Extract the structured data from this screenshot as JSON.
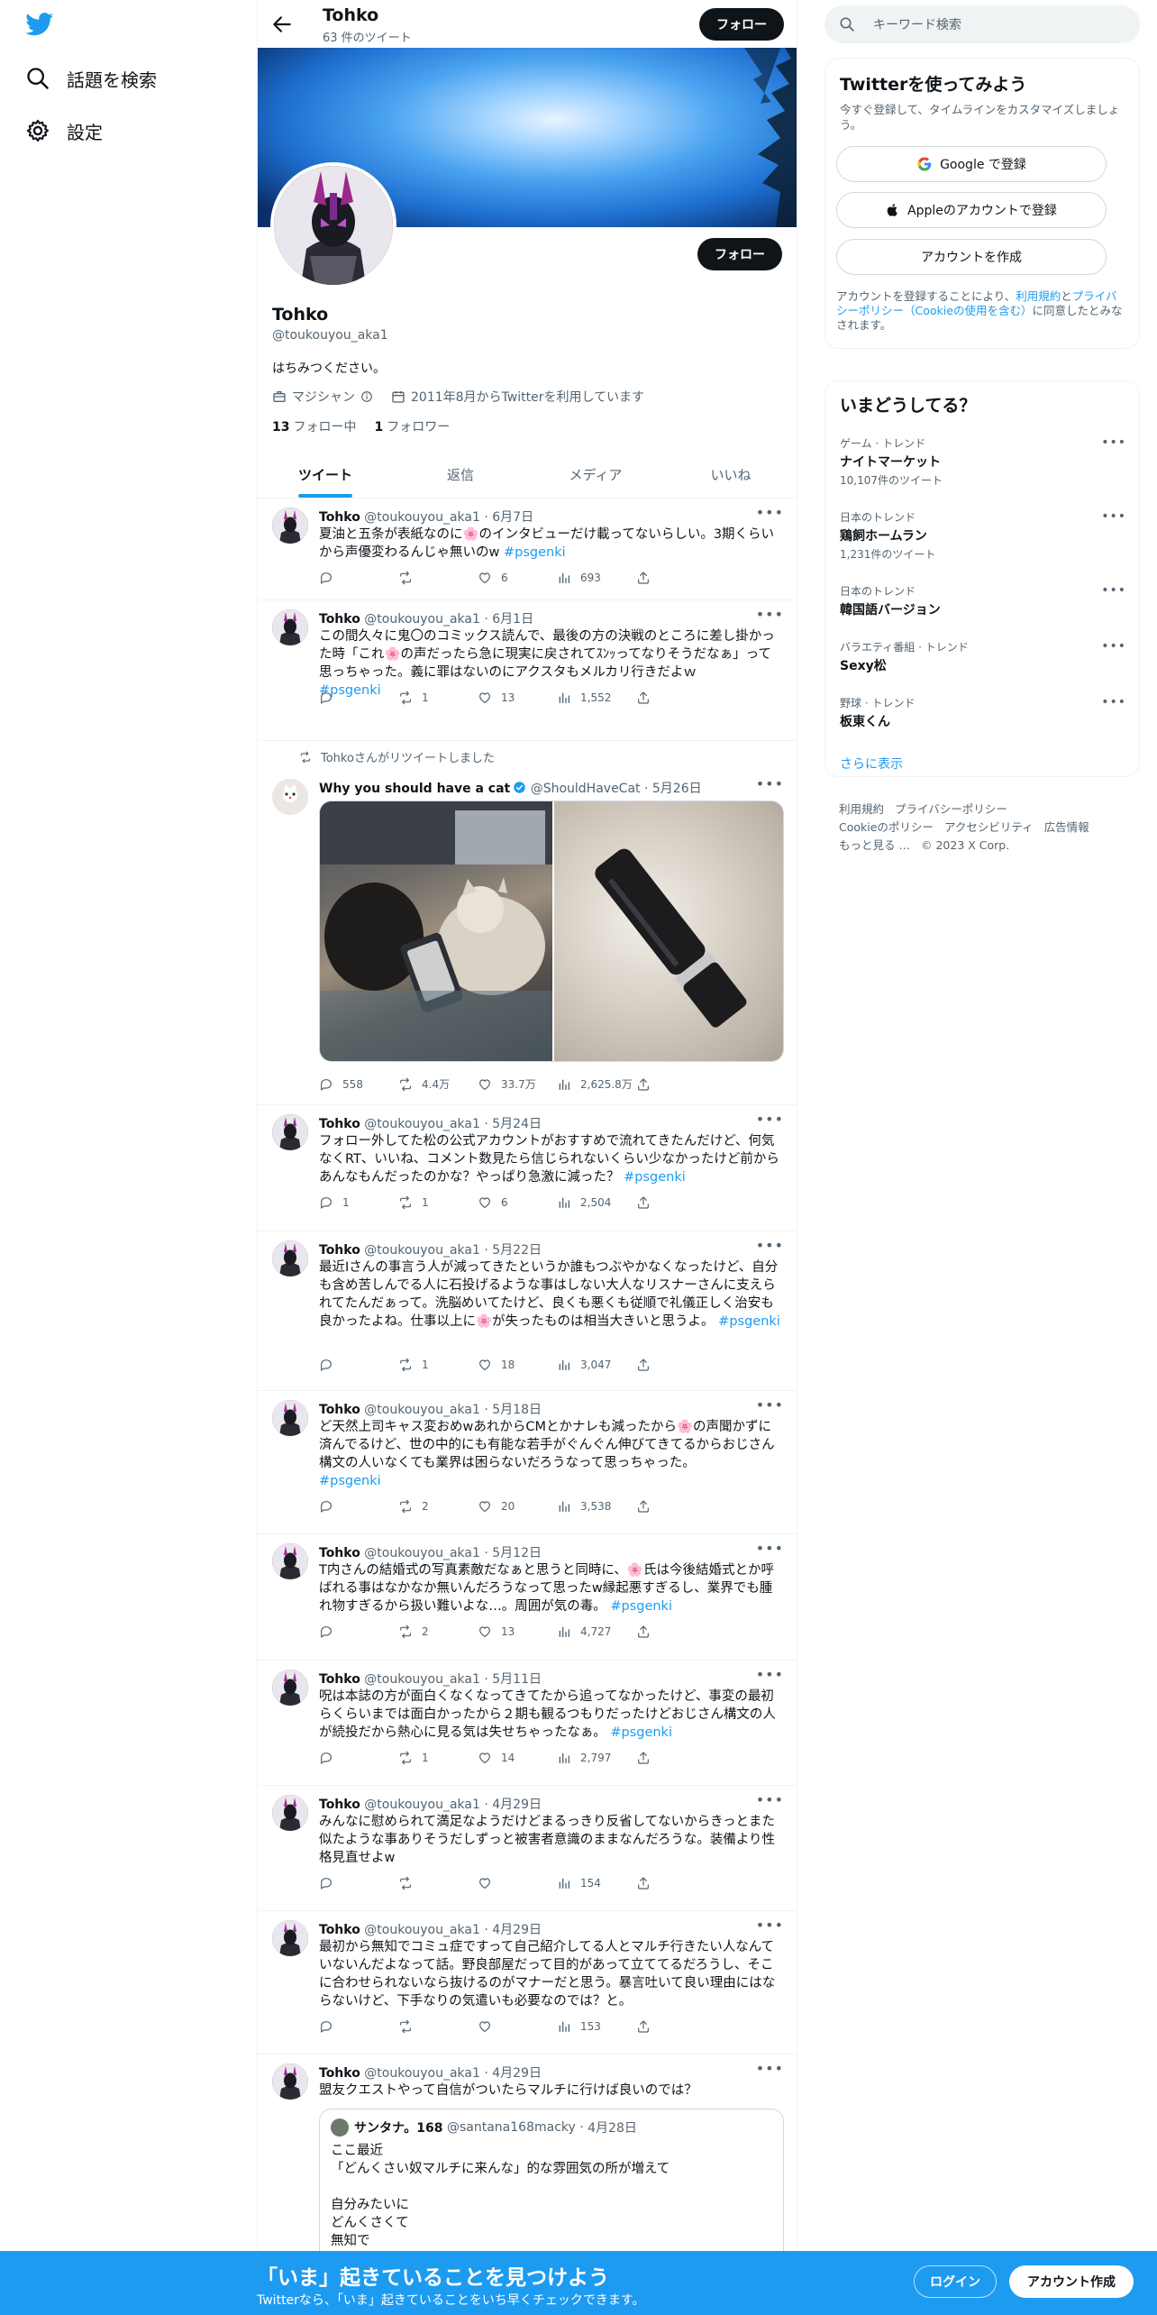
{
  "nav": {
    "explore_label": "話題を検索",
    "settings_label": "設定"
  },
  "header": {
    "name": "Tohko",
    "tweet_count": "63 件のツイート",
    "follow_label": "フォロー"
  },
  "profile": {
    "follow_label": "フォロー",
    "name": "Tohko",
    "handle": "@toukouyou_aka1",
    "bio": "はちみつください。",
    "job": "マジシャン",
    "joined": "2011年8月からTwitterを利用しています",
    "following_count": "13",
    "following_label": "フォロー中",
    "followers_count": "1",
    "followers_label": "フォロワー"
  },
  "tabs": [
    "ツイート",
    "返信",
    "メディア",
    "いいね"
  ],
  "tweets": [
    {
      "name": "Tohko",
      "handle": "@toukouyou_aka1",
      "date": "6月7日",
      "text": "夏油と五条が表紙なのに🌸のインタビューだけ載ってないらしい。3期くらいから声優変わるんじゃ無いのw ",
      "tag": "#psgenki",
      "reply": "",
      "retweet": "",
      "like": "6",
      "views": "693"
    },
    {
      "name": "Tohko",
      "handle": "@toukouyou_aka1",
      "date": "6月1日",
      "text": "この間久々に鬼〇のコミックス読んで、最後の方の決戦のところに差し掛かった時「これ🌸の声だったら急に現実に戻されてｽﾝｯってなりそうだなぁ」って思っちゃった。義に罪はないのにアクスタもメルカリ行きだよｗ\n",
      "tag": "#psgenki",
      "reply": "",
      "retweet": "1",
      "like": "13",
      "views": "1,552"
    },
    {
      "retweeted_by": "Tohkoさんがリツイートしました",
      "name": "Why you should have a cat",
      "handle": "@ShouldHaveCat",
      "date": "5月26日",
      "text": "",
      "tag": "",
      "reply": "558",
      "retweet": "4.4万",
      "like": "33.7万",
      "views": "2,625.8万"
    },
    {
      "name": "Tohko",
      "handle": "@toukouyou_aka1",
      "date": "5月24日",
      "text": "フォロー外してた松の公式アカウントがおすすめで流れてきたんだけど、何気なくRT、いいね、コメント数見たら信じられないくらい少なかったけど前からあんなもんだったのかな？やっぱり急激に減った？ ",
      "tag": "#psgenki",
      "reply": "1",
      "retweet": "1",
      "like": "6",
      "views": "2,504"
    },
    {
      "name": "Tohko",
      "handle": "@toukouyou_aka1",
      "date": "5月22日",
      "text": "最近Iさんの事言う人が減ってきたというか誰もつぶやかなくなったけど、自分も含め苦しんでる人に石投げるような事はしない大人なリスナーさんに支えられてたんだぁって。洗脳めいてたけど、良くも悪くも従順で礼儀正しく治安も良かったよね。仕事以上に🌸が失ったものは相当大きいと思うよ。 ",
      "tag": "#psgenki",
      "reply": "",
      "retweet": "1",
      "like": "18",
      "views": "3,047"
    },
    {
      "name": "Tohko",
      "handle": "@toukouyou_aka1",
      "date": "5月18日",
      "text": "ど天然上司キャス変おめwあれからCMとかナレも減ったから🌸の声聞かずに済んでるけど、世の中的にも有能な若手がぐんぐん伸びてきてるからおじさん構文の人いなくても業界は困らないだろうなって思っちゃった。\n",
      "tag": "#psgenki",
      "reply": "",
      "retweet": "2",
      "like": "20",
      "views": "3,538"
    },
    {
      "name": "Tohko",
      "handle": "@toukouyou_aka1",
      "date": "5月12日",
      "text": "T内さんの結婚式の写真素敵だなぁと思うと同時に、🌸氏は今後結婚式とか呼ばれる事はなかなか無いんだろうなって思ったw縁起悪すぎるし、業界でも腫れ物すぎるから扱い難いよな…。周囲が気の毒。 ",
      "tag": "#psgenki",
      "reply": "",
      "retweet": "2",
      "like": "13",
      "views": "4,727"
    },
    {
      "name": "Tohko",
      "handle": "@toukouyou_aka1",
      "date": "5月11日",
      "text": "呪は本誌の方が面白くなくなってきてたから追ってなかったけど、事変の最初らくらいまでは面白かったから２期も観るつもりだったけどおじさん構文の人が続投だから熱心に見る気は失せちゃったなぁ。 ",
      "tag": "#psgenki",
      "reply": "",
      "retweet": "1",
      "like": "14",
      "views": "2,797"
    },
    {
      "name": "Tohko",
      "handle": "@toukouyou_aka1",
      "date": "4月29日",
      "text": "みんなに慰められて満足なようだけどまるっきり反省してないからきっとまた似たような事ありそうだしずっと被害者意識のままなんだろうな。装備より性格見直せよw",
      "tag": "",
      "reply": "",
      "retweet": "",
      "like": "",
      "views": "154"
    },
    {
      "name": "Tohko",
      "handle": "@toukouyou_aka1",
      "date": "4月29日",
      "text": "最初から無知でコミュ症ですって自己紹介してる人とマルチ行きたい人なんていないんだよなって話。野良部屋だって目的があって立ててるだろうし、そこに合わせられないなら抜けるのがマナーだと思う。暴言吐いて良い理由にはならないけど、下手なりの気遣いも必要なのでは？と。",
      "tag": "",
      "reply": "",
      "retweet": "",
      "like": "",
      "views": "153"
    },
    {
      "name": "Tohko",
      "handle": "@toukouyou_aka1",
      "date": "4月29日",
      "text": "盟友クエストやって自信がついたらマルチに行けば良いのでは？",
      "tag": "",
      "reply": "",
      "retweet": "",
      "like": "",
      "views": ""
    }
  ],
  "quote": {
    "name": "サンタナ。168",
    "handle": "@santana168macky",
    "date": "4月28日",
    "text": "ここ最近\n「どんくさい奴マルチに来んな」的な雰囲気の所が増えて\n\n自分みたいに\nどんくさくて\n無知で"
  },
  "search": {
    "placeholder": "キーワード検索"
  },
  "signup": {
    "title": "Twitterを使ってみよう",
    "subtitle": "今すぐ登録して、タイムラインをカスタマイズしましょう。",
    "google_label": "Google で登録",
    "apple_label": "Appleのアカウントで登録",
    "create_label": "アカウントを作成",
    "legal_prefix": "アカウントを登録することにより、",
    "legal_terms": "利用規約",
    "legal_and": "と",
    "legal_privacy": "プライバシーポリシー",
    "legal_cookie": "（Cookieの使用を含む）",
    "legal_suffix": "に同意したとみなされます。"
  },
  "trends": {
    "title": "いまどうしてる？",
    "items": [
      {
        "category": "ゲーム · トレンド",
        "name": "ナイトマーケット",
        "count": "10,107件のツイート"
      },
      {
        "category": "日本のトレンド",
        "name": "鶏飼ホームラン",
        "count": "1,231件のツイート"
      },
      {
        "category": "日本のトレンド",
        "name": "韓国語バージョン",
        "count": ""
      },
      {
        "category": "バラエティ番組 · トレンド",
        "name": "Sexy松",
        "count": ""
      },
      {
        "category": "野球 · トレンド",
        "name": "板東くん",
        "count": ""
      }
    ],
    "more_label": "さらに表示"
  },
  "footer": {
    "terms": "利用規約",
    "privacy": "プライバシーポリシー",
    "cookie": "Cookieのポリシー",
    "accessibility": "アクセシビリティ",
    "ads": "広告情報",
    "more": "もっと見る …",
    "copyright": "© 2023 X Corp."
  },
  "bottom": {
    "title": "「いま」起きていることを見つけよう",
    "subtitle": "Twitterなら、「いま」起きていることをいち早くチェックできます。",
    "login_label": "ログイン",
    "signup_label": "アカウント作成"
  },
  "colors": {
    "accent": "#1d9bf0",
    "text": "#0f1419",
    "muted": "#536471",
    "border": "#eff3f4"
  }
}
